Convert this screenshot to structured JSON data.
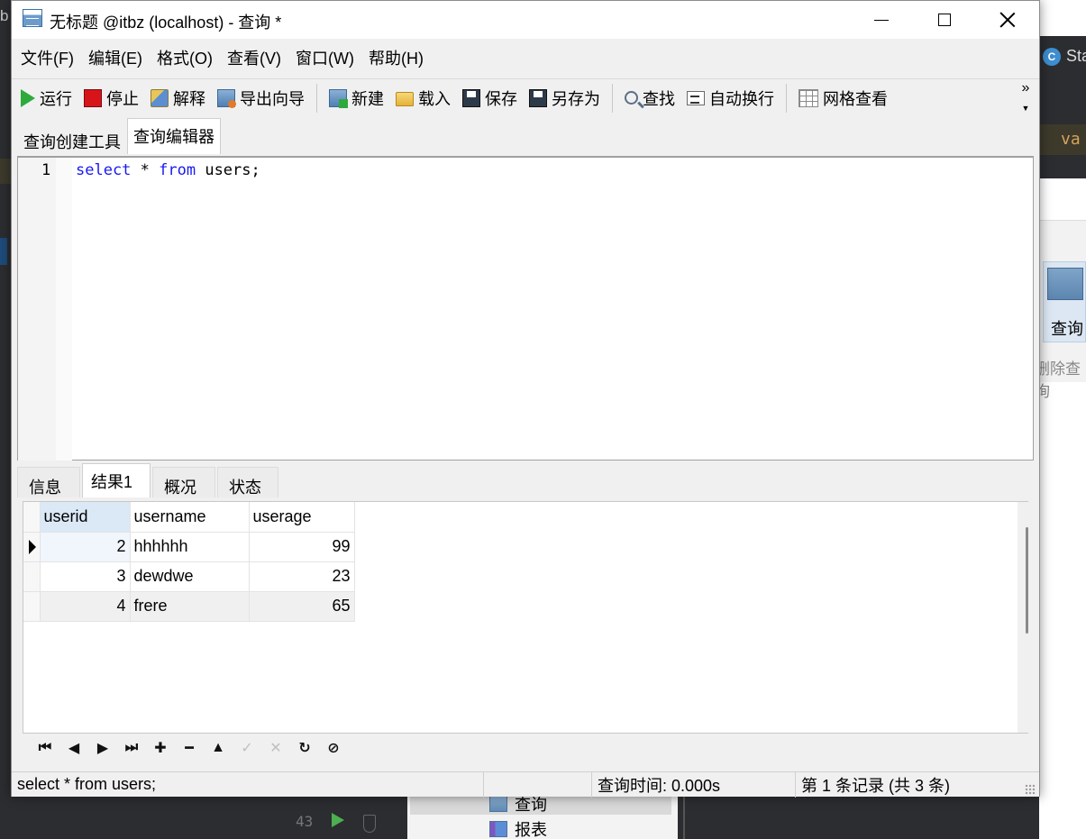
{
  "window": {
    "title": "无标题 @itbz (localhost) - 查询 *"
  },
  "menu": [
    "文件(F)",
    "编辑(E)",
    "格式(O)",
    "查看(V)",
    "窗口(W)",
    "帮助(H)"
  ],
  "toolbar": {
    "run": "运行",
    "stop": "停止",
    "explain": "解释",
    "export_wizard": "导出向导",
    "new": "新建",
    "load": "载入",
    "save": "保存",
    "save_as": "另存为",
    "find": "查找",
    "word_wrap": "自动换行",
    "grid_view": "网格查看",
    "more": "»"
  },
  "query_tabs": [
    "查询创建工具",
    "查询编辑器"
  ],
  "editor": {
    "line_number": "1",
    "tokens": [
      "select",
      " * ",
      "from",
      " users;"
    ]
  },
  "result_tabs": [
    "信息",
    "结果1",
    "概况",
    "状态"
  ],
  "results": {
    "columns": [
      "userid",
      "username",
      "userage"
    ],
    "rows": [
      [
        "2",
        "hhhhhh",
        "99"
      ],
      [
        "3",
        "dewdwe",
        "23"
      ],
      [
        "4",
        "frere",
        "65"
      ]
    ]
  },
  "status": {
    "sql": "select * from users;",
    "query_time": "查询时间: 0.000s",
    "records": "第 1 条记录 (共 3 条)"
  },
  "background": {
    "left_chars": "b",
    "right_tab": "Sta",
    "right_code": "va",
    "right_query_btn": "查询",
    "right_delete": "删除查询",
    "line_number": "43",
    "tree_items": [
      "查询",
      "报表"
    ]
  },
  "colors": {
    "keyword": "#1a1af0",
    "run_green": "#2eaa3c",
    "stop_red": "#d8141b",
    "selected_header": "#dbe8f6"
  }
}
